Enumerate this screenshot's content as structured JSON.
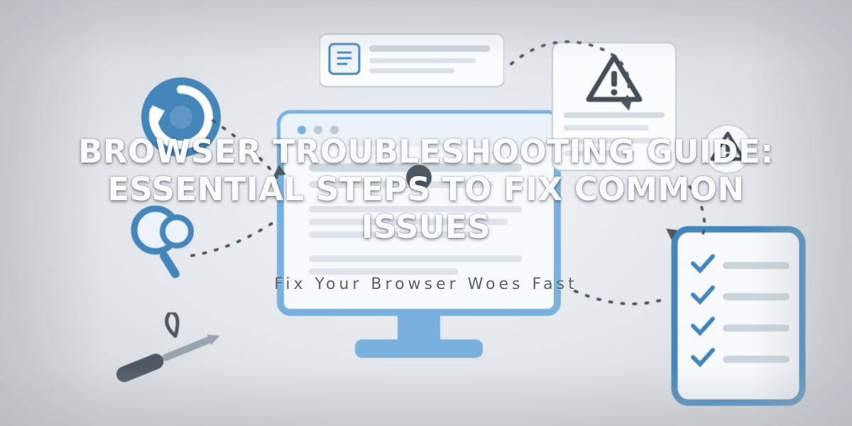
{
  "hero": {
    "title": "BROWSER TROUBLESHOOTING GUIDE: ESSENTIAL STEPS TO FIX COMMON ISSUES",
    "subtitle": "Fix Your Browser Woes Fast"
  },
  "illustration": {
    "accent": "#2f78b3",
    "accent_light": "#6aa9d8",
    "neutral": "#8f9aa5",
    "elements": [
      "monitor",
      "document-card",
      "warning-badge",
      "tablet-checklist",
      "refresh-circle-icon",
      "magnifier-icon",
      "screwdriver-icon",
      "dashed-connector"
    ]
  }
}
